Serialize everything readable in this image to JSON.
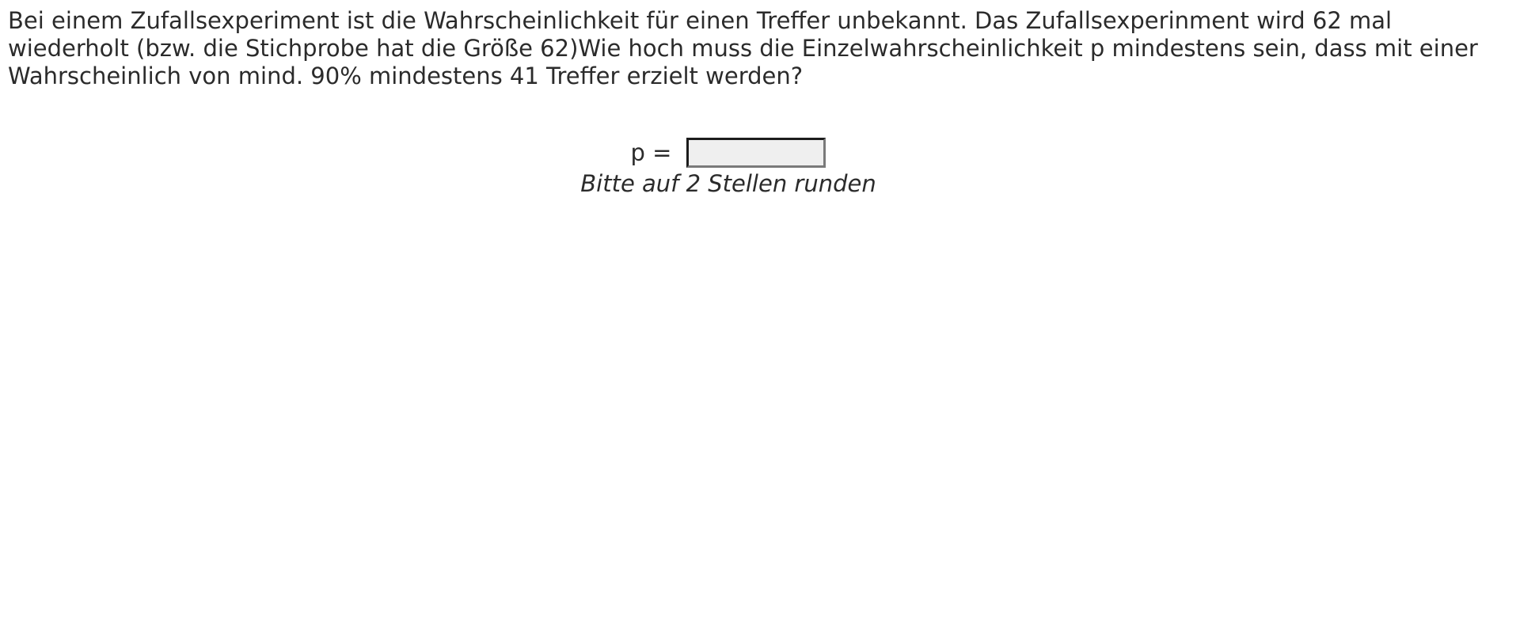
{
  "question": {
    "text": "Bei einem Zufallsexperiment ist die Wahrscheinlichkeit für einen Treffer unbekannt. Das Zufallsexperinment wird 62 mal wiederholt (bzw. die Stichprobe hat die Größe 62)Wie hoch muss die Einzelwahrscheinlichkeit p mindestens sein, dass mit einer Wahrscheinlich von mind. 90% mindestens 41 Treffer erzielt werden?"
  },
  "answer": {
    "label": "p =",
    "value": "",
    "hint": "Bitte auf 2 Stellen runden"
  }
}
